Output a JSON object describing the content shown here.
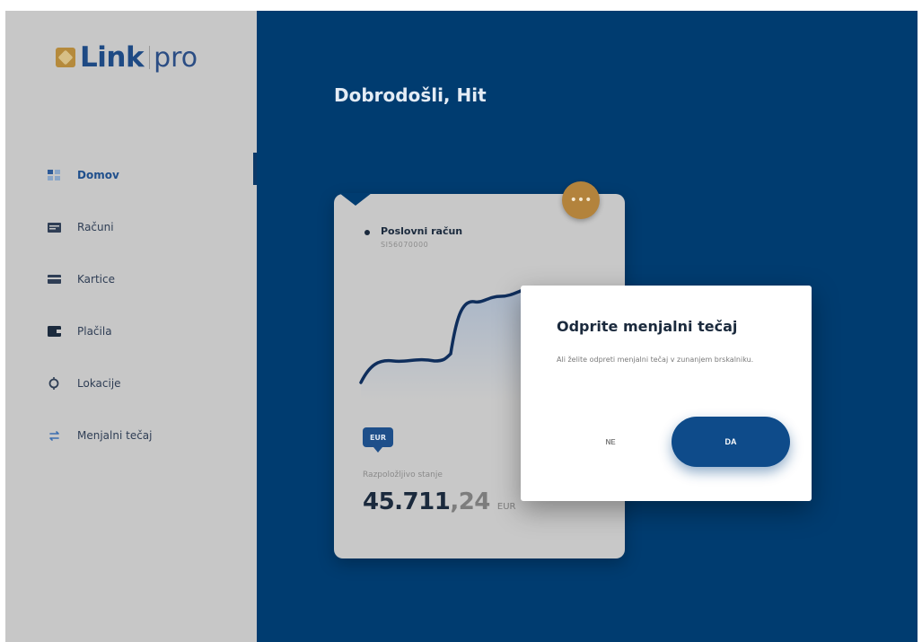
{
  "brand": {
    "name": "Link",
    "suffix": "pro",
    "colors": {
      "primary": "#003c70",
      "accent": "#b3833c",
      "sidebar": "#c7c7c7"
    }
  },
  "sidebar": {
    "items": [
      {
        "label": "Domov",
        "icon": "home-grid-icon",
        "active": true
      },
      {
        "label": "Računi",
        "icon": "accounts-icon",
        "active": false
      },
      {
        "label": "Kartice",
        "icon": "card-icon",
        "active": false
      },
      {
        "label": "Plačila",
        "icon": "wallet-icon",
        "active": false
      },
      {
        "label": "Lokacije",
        "icon": "location-icon",
        "active": false
      },
      {
        "label": "Menjalni tečaj",
        "icon": "exchange-icon",
        "active": false
      }
    ]
  },
  "main": {
    "greeting": "Dobrodošli, Hit"
  },
  "account_card": {
    "more_label": "•••",
    "name": "Poslovni račun",
    "number": "SI56070000",
    "currency": "EUR",
    "balance_label": "Razpoložljivo stanje",
    "balance_int": "45.711",
    "balance_dec": ",24",
    "balance_currency": "EUR"
  },
  "dialog": {
    "title": "Odprite menjalni tečaj",
    "body": "Ali želite odpreti menjalni tečaj v zunanjem brskalniku.",
    "no_label": "NE",
    "yes_label": "DA"
  }
}
